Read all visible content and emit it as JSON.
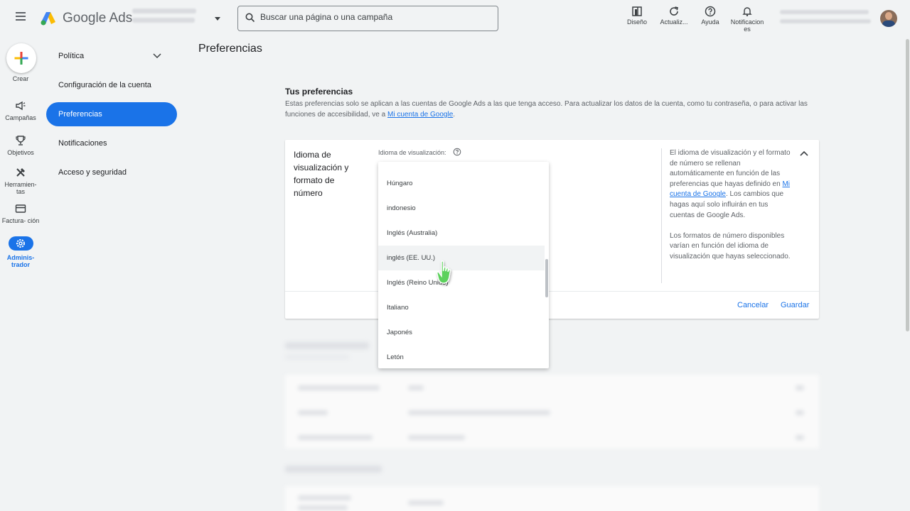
{
  "header": {
    "brand": "Google Ads",
    "search_placeholder": "Buscar una página o una campaña",
    "tools": [
      {
        "label": "Diseño",
        "icon": "layout-icon"
      },
      {
        "label": "Actualiz...",
        "icon": "refresh-icon"
      },
      {
        "label": "Ayuda",
        "icon": "help-icon"
      },
      {
        "label": "Notificacion es",
        "icon": "bell-icon"
      }
    ]
  },
  "rail": {
    "create": "Crear",
    "campaigns": "Campañas",
    "goals": "Objetivos",
    "tools": "Herramien- tas",
    "billing": "Factura- ción",
    "admin": "Adminis- trador"
  },
  "subnav": {
    "policy": "Política",
    "account_settings": "Configuración de la cuenta",
    "preferences": "Preferencias",
    "notifications": "Notificaciones",
    "access_security": "Acceso y seguridad"
  },
  "main": {
    "page_title": "Preferencias",
    "section_title": "Tus preferencias",
    "section_desc": "Estas preferencias solo se aplican a las cuentas de Google Ads a las que tenga acceso. Para actualizar los datos de la cuenta, como tu contraseña, o para activar las funciones de accesibilidad, ve a ",
    "section_link": "Mi cuenta de Google",
    "section_desc_end": ".",
    "card": {
      "label": "Idioma de visualización y formato de número",
      "field_label": "Idioma de visualización:",
      "info_p1_a": "El idioma de visualización y el formato de número se rellenan automáticamente en función de las preferencias que hayas definido en ",
      "info_link": "Mi cuenta de Google",
      "info_p1_b": ". Los cambios que hagas aquí solo influirán en tus cuentas de Google Ads.",
      "info_p2": "Los formatos de número disponibles varían en función del idioma de visualización que hayas seleccionado.",
      "cancel": "Cancelar",
      "save": "Guardar"
    },
    "dropdown_options": [
      "Húngaro",
      "indonesio",
      "Inglés (Australia)",
      "inglés (EE. UU.)",
      "Inglés (Reino Unido)",
      "Italiano",
      "Japonés",
      "Letón"
    ],
    "hovered_option": "inglés (EE. UU.)"
  },
  "colors": {
    "accent": "#1a73e8",
    "background": "#f1f3f4"
  }
}
